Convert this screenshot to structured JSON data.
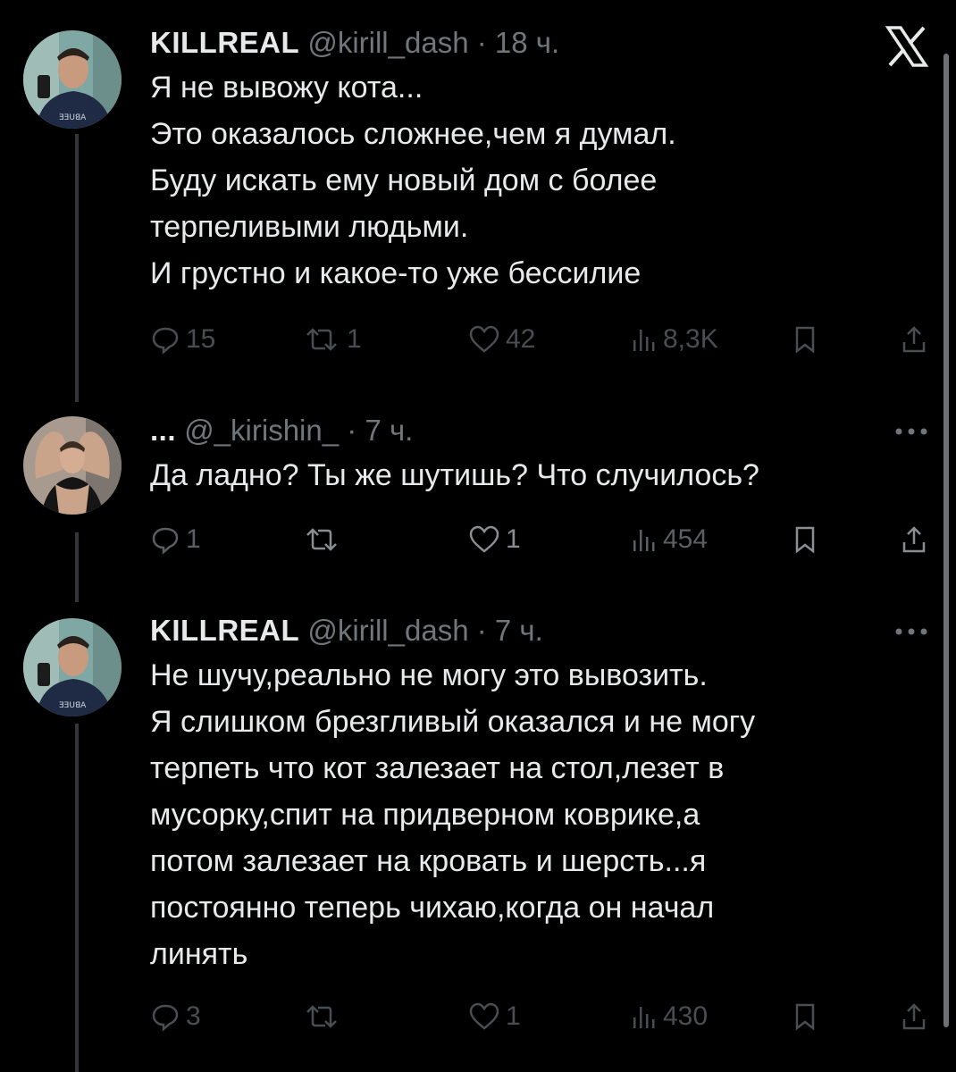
{
  "app": {
    "logo": "x-logo-icon"
  },
  "tweets": [
    {
      "author_name": "KILLREAL",
      "handle": "@kirill_dash",
      "separator": "·",
      "time": "18 ч.",
      "lines": [
        "Я не вывожу кота...",
        "Это оказалось сложнее,чем я думал.",
        "Буду искать ему новый дом с более",
        "терпеливыми людьми.",
        "И грустно и какое-то уже бессилие"
      ],
      "replies": "15",
      "reposts": "1",
      "likes": "42",
      "views": "8,3K"
    },
    {
      "author_name": "...",
      "handle": "@_kirishin_",
      "separator": "·",
      "time": "7 ч.",
      "lines": [
        "Да ладно? Ты же шутишь? Что случилось?"
      ],
      "replies": "1",
      "reposts": "",
      "likes": "1",
      "views": "454"
    },
    {
      "author_name": "KILLREAL",
      "handle": "@kirill_dash",
      "separator": "·",
      "time": "7 ч.",
      "lines": [
        "Не шучу,реально не могу это вывозить.",
        "Я слишком брезгливый оказался и не могу",
        "терпеть что кот залезает на стол,лезет в",
        "мусорку,спит на придверном коврике,а",
        "потом залезает на кровать и шерсть...я",
        "постоянно теперь чихаю,когда он начал",
        "линять"
      ],
      "replies": "3",
      "reposts": "",
      "likes": "1",
      "views": "430"
    }
  ],
  "colors": {
    "background": "#000000",
    "text": "#e7e9ea",
    "secondary": "#71767b",
    "thread_line": "#33363b"
  }
}
